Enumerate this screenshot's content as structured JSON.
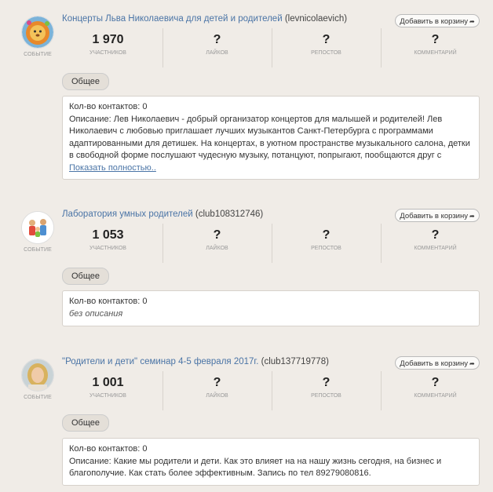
{
  "items": [
    {
      "title": "Концерты Льва Николаевича для детей и родителей",
      "handle": "(levnicolaevich)",
      "type": "СОБЫТИЕ",
      "cart": "Добавить в корзину",
      "stats": [
        {
          "value": "1 970",
          "label": "УЧАСТНИКОВ"
        },
        {
          "value": "?",
          "label": "ЛАЙКОВ"
        },
        {
          "value": "?",
          "label": "РЕПОСТОВ"
        },
        {
          "value": "?",
          "label": "КОММЕНТАРИЙ"
        }
      ],
      "tag": "Общее",
      "contacts": "Кол-во контактов: 0",
      "description": "Описание: Лев Николаевич - добрый организатор концертов для малышей и родителей! Лев Николаевич с любовью приглашает лучших музыкантов Санкт-Петербурга с программами адаптированными для детишек. На концертах, в уютном пространстве музыкального салона, детки в свободной форме послушают чудесную музыку, потанцуют, попрыгают, пообщаются друг с",
      "more": "Показать полностью.."
    },
    {
      "title": "Лаборатория умных родителей",
      "handle": "(club108312746)",
      "type": "СОБЫТИЕ",
      "cart": "Добавить в корзину",
      "stats": [
        {
          "value": "1 053",
          "label": "УЧАСТНИКОВ"
        },
        {
          "value": "?",
          "label": "ЛАЙКОВ"
        },
        {
          "value": "?",
          "label": "РЕПОСТОВ"
        },
        {
          "value": "?",
          "label": "КОММЕНТАРИЙ"
        }
      ],
      "tag": "Общее",
      "contacts": "Кол-во контактов: 0",
      "empty": "без описания"
    },
    {
      "title": "\"Родители и дети\" семинар 4-5 февраля 2017г.",
      "handle": "(club137719778)",
      "type": "СОБЫТИЕ",
      "cart": "Добавить в корзину",
      "stats": [
        {
          "value": "1 001",
          "label": "УЧАСТНИКОВ"
        },
        {
          "value": "?",
          "label": "ЛАЙКОВ"
        },
        {
          "value": "?",
          "label": "РЕПОСТОВ"
        },
        {
          "value": "?",
          "label": "КОММЕНТАРИЙ"
        }
      ],
      "tag": "Общее",
      "contacts": "Кол-во контактов: 0",
      "description": "Описание: Какие мы родители и дети. Как это влияет на на нашу жизнь сегодня, на бизнес и благополучие. Как стать более эффективным. Запись по тел 89279080816."
    }
  ]
}
